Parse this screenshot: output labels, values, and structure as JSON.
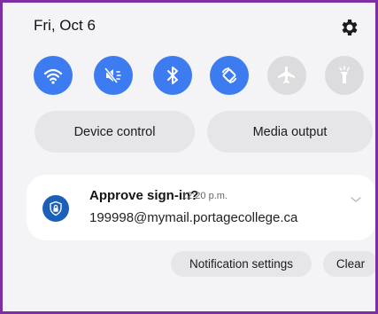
{
  "header": {
    "date": "Fri, Oct 6"
  },
  "quick_settings": [
    {
      "icon": "wifi-icon",
      "state": "on"
    },
    {
      "icon": "sound-muted-icon",
      "state": "on"
    },
    {
      "icon": "bluetooth-icon",
      "state": "on"
    },
    {
      "icon": "auto-rotate-icon",
      "state": "on"
    },
    {
      "icon": "airplane-mode-icon",
      "state": "off"
    },
    {
      "icon": "flashlight-icon",
      "state": "off"
    }
  ],
  "controls": {
    "device_control": "Device control",
    "media_output": "Media output"
  },
  "notification": {
    "app_icon": "lock-shield-icon",
    "title": "Approve sign-in?",
    "time": "12:20 p.m.",
    "body": "199998@mymail.portagecollege.ca"
  },
  "actions": {
    "settings": "Notification settings",
    "clear": "Clear"
  },
  "colors": {
    "accent": "#3d7cf0",
    "inactive": "#dcdcdf",
    "frame": "#7b2fa3",
    "app_icon": "#1b5fb8"
  }
}
